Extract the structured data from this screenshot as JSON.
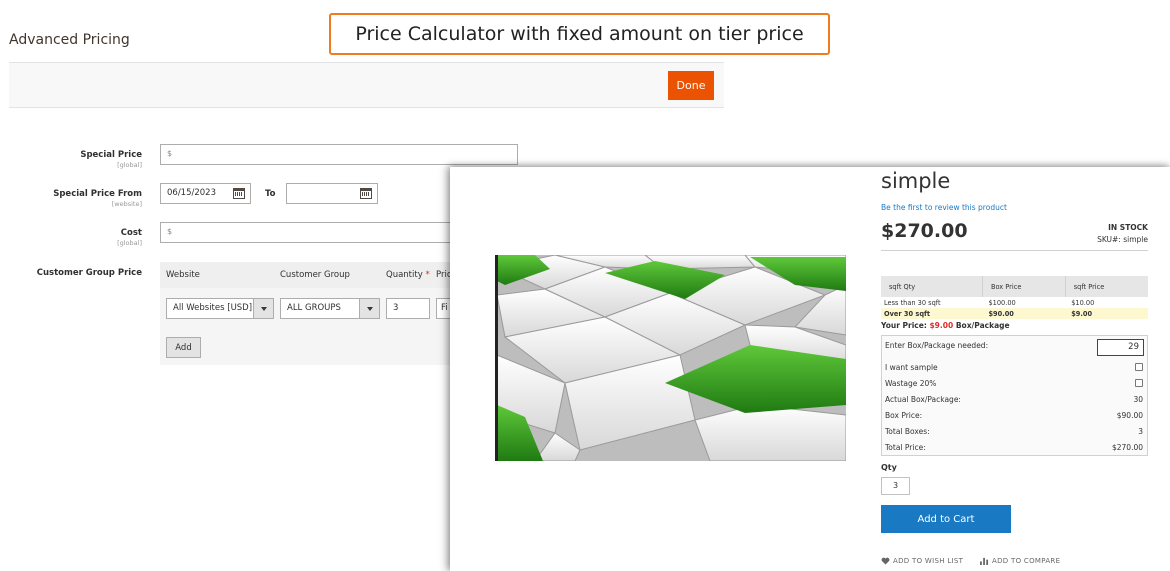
{
  "admin": {
    "title": "Advanced Pricing",
    "banner": "Price Calculator with fixed amount on tier price",
    "done_label": "Done",
    "special_price": {
      "label": "Special Price",
      "scope": "[global]",
      "currency": "$"
    },
    "special_from": {
      "label": "Special Price From",
      "scope": "[website]",
      "from_value": "06/15/2023",
      "to_label": "To",
      "to_value": ""
    },
    "cost": {
      "label": "Cost",
      "scope": "[global]",
      "currency": "$"
    },
    "customer_group_price": {
      "label": "Customer Group Price",
      "columns": [
        "Website",
        "Customer Group",
        "Quantity",
        "Pric"
      ],
      "required_mark": "*",
      "row": {
        "website": "All Websites [USD]",
        "group": "ALL GROUPS",
        "quantity": "3",
        "price_type": "Fi"
      },
      "add_label": "Add"
    }
  },
  "product": {
    "name": "simple",
    "review_link": "Be the first to review this product",
    "price": "$270.00",
    "stock": "IN STOCK",
    "sku_label": "SKU#:",
    "sku": "simple",
    "tier_table": {
      "headers": [
        "sqft Qty",
        "Box Price",
        "sqft Price"
      ],
      "rows": [
        [
          "Less than 30 sqft",
          "$100.00",
          "$10.00"
        ],
        [
          "Over 30 sqft",
          "$90.00",
          "$9.00"
        ]
      ]
    },
    "your_price": {
      "prefix": "Your Price:",
      "amount": "$9.00",
      "suffix": "Box/Package"
    },
    "calculator": {
      "needed_label": "Enter Box/Package needed:",
      "needed_value": "29",
      "sample_label": "I want sample",
      "wastage_label": "Wastage 20%",
      "actual_label": "Actual Box/Package:",
      "actual_value": "30",
      "box_price_label": "Box Price:",
      "box_price_value": "$90.00",
      "total_boxes_label": "Total Boxes:",
      "total_boxes_value": "3",
      "total_price_label": "Total Price:",
      "total_price_value": "$270.00"
    },
    "qty_label": "Qty",
    "qty_value": "3",
    "add_to_cart": "Add to Cart",
    "wishlist": "ADD TO WISH LIST",
    "compare": "ADD TO COMPARE",
    "icons": {
      "wishlist": "heart-icon",
      "compare": "bar-chart-icon",
      "calendar": "calendar-icon"
    },
    "colors": {
      "primary_button": "#1979c3",
      "done_button": "#eb5202",
      "banner_border": "#ef7d1f",
      "price_red": "#e02b27"
    }
  }
}
